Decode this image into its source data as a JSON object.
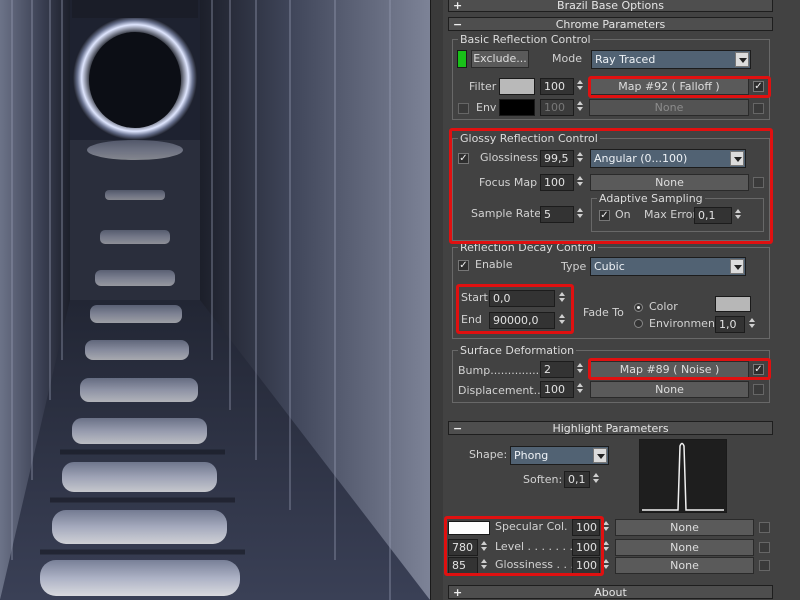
{
  "colors": {
    "highlight": "#e01010",
    "combo_bg": "#516273",
    "green_swatch": "#19c019"
  },
  "icons": {
    "rollout_expand": "+",
    "rollout_collapse": "−",
    "check": "✓"
  },
  "render": {
    "description_icon": "render-preview"
  },
  "rollouts": {
    "brazil_base": {
      "toggle": "+",
      "label": "Brazil Base Options"
    },
    "chrome": {
      "toggle": "−",
      "label": "Chrome Parameters"
    },
    "highlight": {
      "toggle": "−",
      "label": "Highlight Parameters"
    },
    "about": {
      "toggle": "+",
      "label": "About"
    }
  },
  "basic_reflection": {
    "title": "Basic Reflection Control",
    "exclude_label": "Exclude...",
    "mode_label": "Mode",
    "mode_value": "Ray Traced",
    "filter_label": "Filter",
    "filter_amount": "100",
    "filter_map": "Map #92  ( Falloff )",
    "filter_map_checked": "✓",
    "env_label": "Env",
    "env_amount": "100",
    "env_map": "None"
  },
  "glossy": {
    "title": "Glossy Reflection Control",
    "glossiness_label": "Glossiness",
    "glossiness_checked": "✓",
    "glossiness_value": "99,5",
    "glossiness_mode": "Angular (0...100)",
    "focus_map_label": "Focus Map",
    "focus_map_amount": "100",
    "focus_map_button": "None",
    "sample_rate_label": "Sample Rate",
    "sample_rate_value": "5",
    "adaptive_title": "Adaptive Sampling",
    "adaptive_on_checked": "✓",
    "adaptive_on_label": "On",
    "max_error_label": "Max Error",
    "max_error_value": "0,1"
  },
  "decay": {
    "title": "Reflection Decay Control",
    "enable_checked": "✓",
    "enable_label": "Enable",
    "type_label": "Type",
    "type_value": "Cubic",
    "start_label": "Start",
    "start_value": "0,0",
    "end_label": "End",
    "end_value": "90000,0",
    "fade_to_label": "Fade To",
    "color_label": "Color",
    "environment_label": "Environment",
    "environment_value": "1,0"
  },
  "surface": {
    "title": "Surface Deformation",
    "bump_label": "Bump.................",
    "bump_value": "2",
    "bump_map": "Map #89  ( Noise )",
    "bump_map_checked": "✓",
    "displacement_label": "Displacement.....",
    "displacement_value": "100",
    "displacement_map": "None"
  },
  "highlight": {
    "shape_label": "Shape:",
    "shape_value": "Phong",
    "soften_label": "Soften:",
    "soften_value": "0,1",
    "specular_label": "Specular Col. . .",
    "specular_amount": "100",
    "specular_map": "None",
    "level_value": "780",
    "level_label": "Level . . . . . . . .",
    "level_amount": "100",
    "level_map": "None",
    "gloss_value": "85",
    "gloss_label": "Glossiness . . . .",
    "gloss_amount": "100",
    "gloss_map": "None"
  }
}
